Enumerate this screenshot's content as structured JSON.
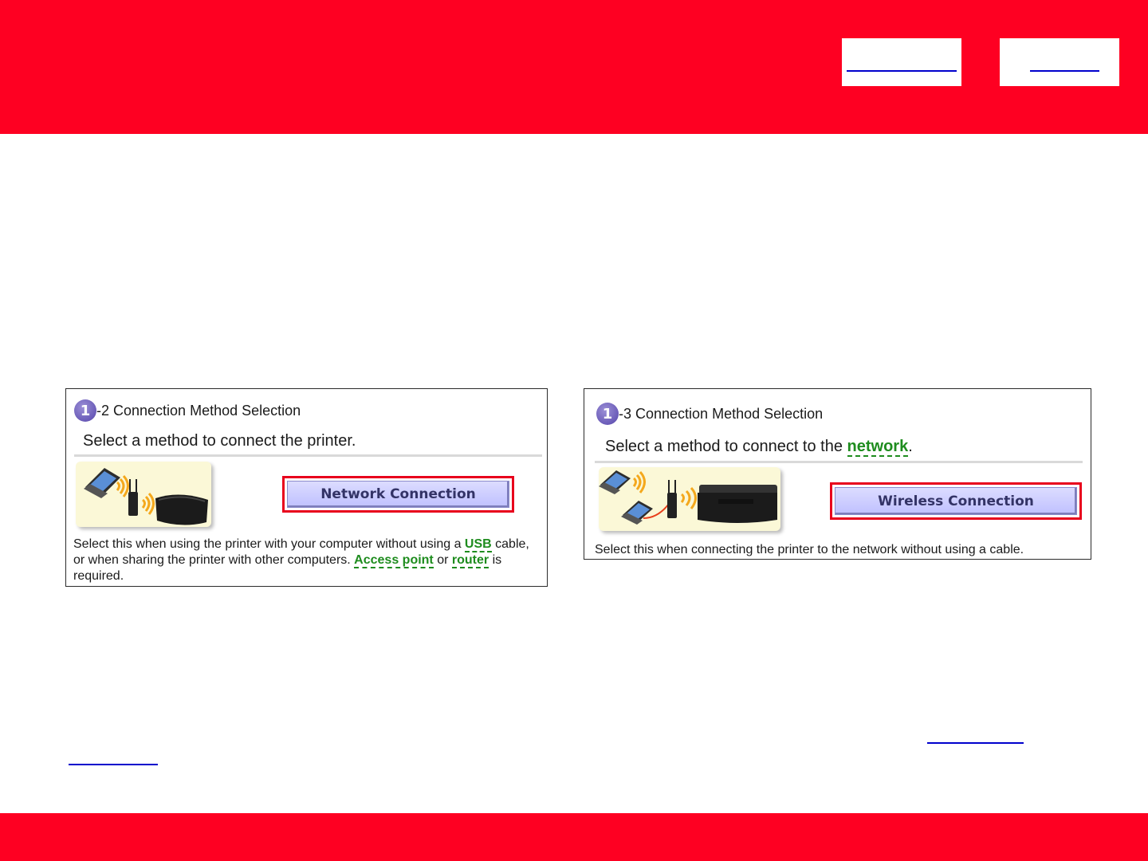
{
  "colors": {
    "brand_red": "#fe0022",
    "link_blue": "#0000cc",
    "keyword_green": "#1e8c1e",
    "highlight_red": "#e8001c"
  },
  "panels": {
    "left": {
      "step_number": "1",
      "step_title": "-2 Connection Method Selection",
      "subtitle": "Select a method to connect the printer.",
      "button_label": "Network Connection",
      "desc_part1": "Select this when using the printer with your computer without using a ",
      "kw_usb": "USB",
      "desc_part2": " cable,",
      "desc_part3": "or when sharing the printer with other computers. ",
      "kw_access_point": "Access point",
      "desc_part4": " or ",
      "kw_router": "router",
      "desc_part5": " is",
      "desc_part6": "required."
    },
    "right": {
      "step_number": "1",
      "step_title": "-3 Connection Method Selection",
      "subtitle_part1": "Select a method to connect to the ",
      "kw_network": "network",
      "subtitle_part2": ".",
      "button_label": "Wireless Connection",
      "description": "Select this when connecting the printer to the network without using a cable."
    }
  }
}
